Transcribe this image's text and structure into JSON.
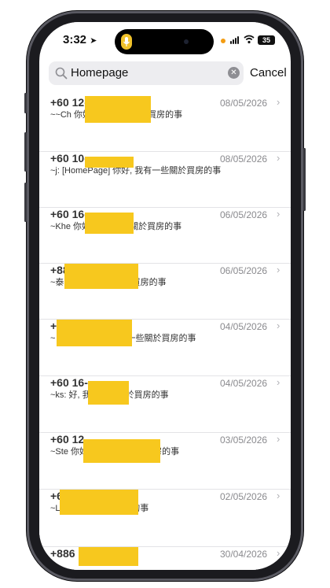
{
  "status_bar": {
    "time": "3:32",
    "battery": "35"
  },
  "search": {
    "query": "Homepage",
    "cancel_label": "Cancel"
  },
  "messages": [
    {
      "title": "+60 12-",
      "date": "08/05/2026",
      "preview": "~~Ch                                 你好, 我有一些關於買房的事"
    },
    {
      "title": "+60 10-",
      "date": "08/05/2026",
      "preview": "~j: [HomePage] 你好, 我有一些關於買房的事"
    },
    {
      "title": "+60 16-",
      "date": "06/05/2026",
      "preview": "~Khe                          你好, 我有一些關於買房的事"
    },
    {
      "title": "+886",
      "date": "06/05/2026",
      "preview": "~泰                                  好, 我有一些關於買房的事"
    },
    {
      "title": "+65",
      "date": "04/05/2026",
      "preview": "~                                     ePage] 你好, 我有一些關於買房的事"
    },
    {
      "title": "+60 16-",
      "date": "04/05/2026",
      "preview": "~ks:                              好, 我有一些關於買房的事"
    },
    {
      "title": "+60 12-",
      "date": "03/05/2026",
      "preview": "~Ste                                        你好, 我有一些關於買房的事"
    },
    {
      "title": "+65 9",
      "date": "02/05/2026",
      "preview": "~L                                   我有一些關於買房的事"
    },
    {
      "title": "+886",
      "date": "30/04/2026",
      "preview": ""
    }
  ]
}
